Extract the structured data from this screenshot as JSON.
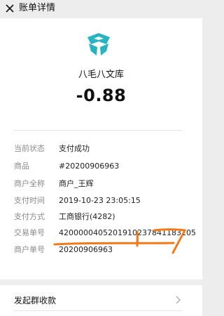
{
  "header": {
    "title": "账单详情",
    "close_icon": "close-icon"
  },
  "merchant": {
    "name": "八毛八文库",
    "logo_icon": "merchant-logo-icon",
    "logo_color": "#27b3c0"
  },
  "amount": "-0.88",
  "details": [
    {
      "label": "当前状态",
      "value": "支付成功"
    },
    {
      "label": "商品",
      "value": "#20200906963"
    },
    {
      "label": "商户全称",
      "value": "商户_王辉"
    },
    {
      "label": "支付时间",
      "value": "2019-10-23 23:05:15"
    },
    {
      "label": "支付方式",
      "value": "工商银行(4282)"
    },
    {
      "label": "交易单号",
      "value": "4200000405201910237841183105"
    },
    {
      "label": "商户单号",
      "value": "20200906963"
    }
  ],
  "actions": {
    "group_collect_label": "发起群收款",
    "chevron_icon": "chevron-right-icon"
  },
  "colors": {
    "background": "#ededed",
    "card": "#ffffff",
    "label_gray": "#8a8a8a",
    "annotation_orange": "#f07a1c"
  }
}
